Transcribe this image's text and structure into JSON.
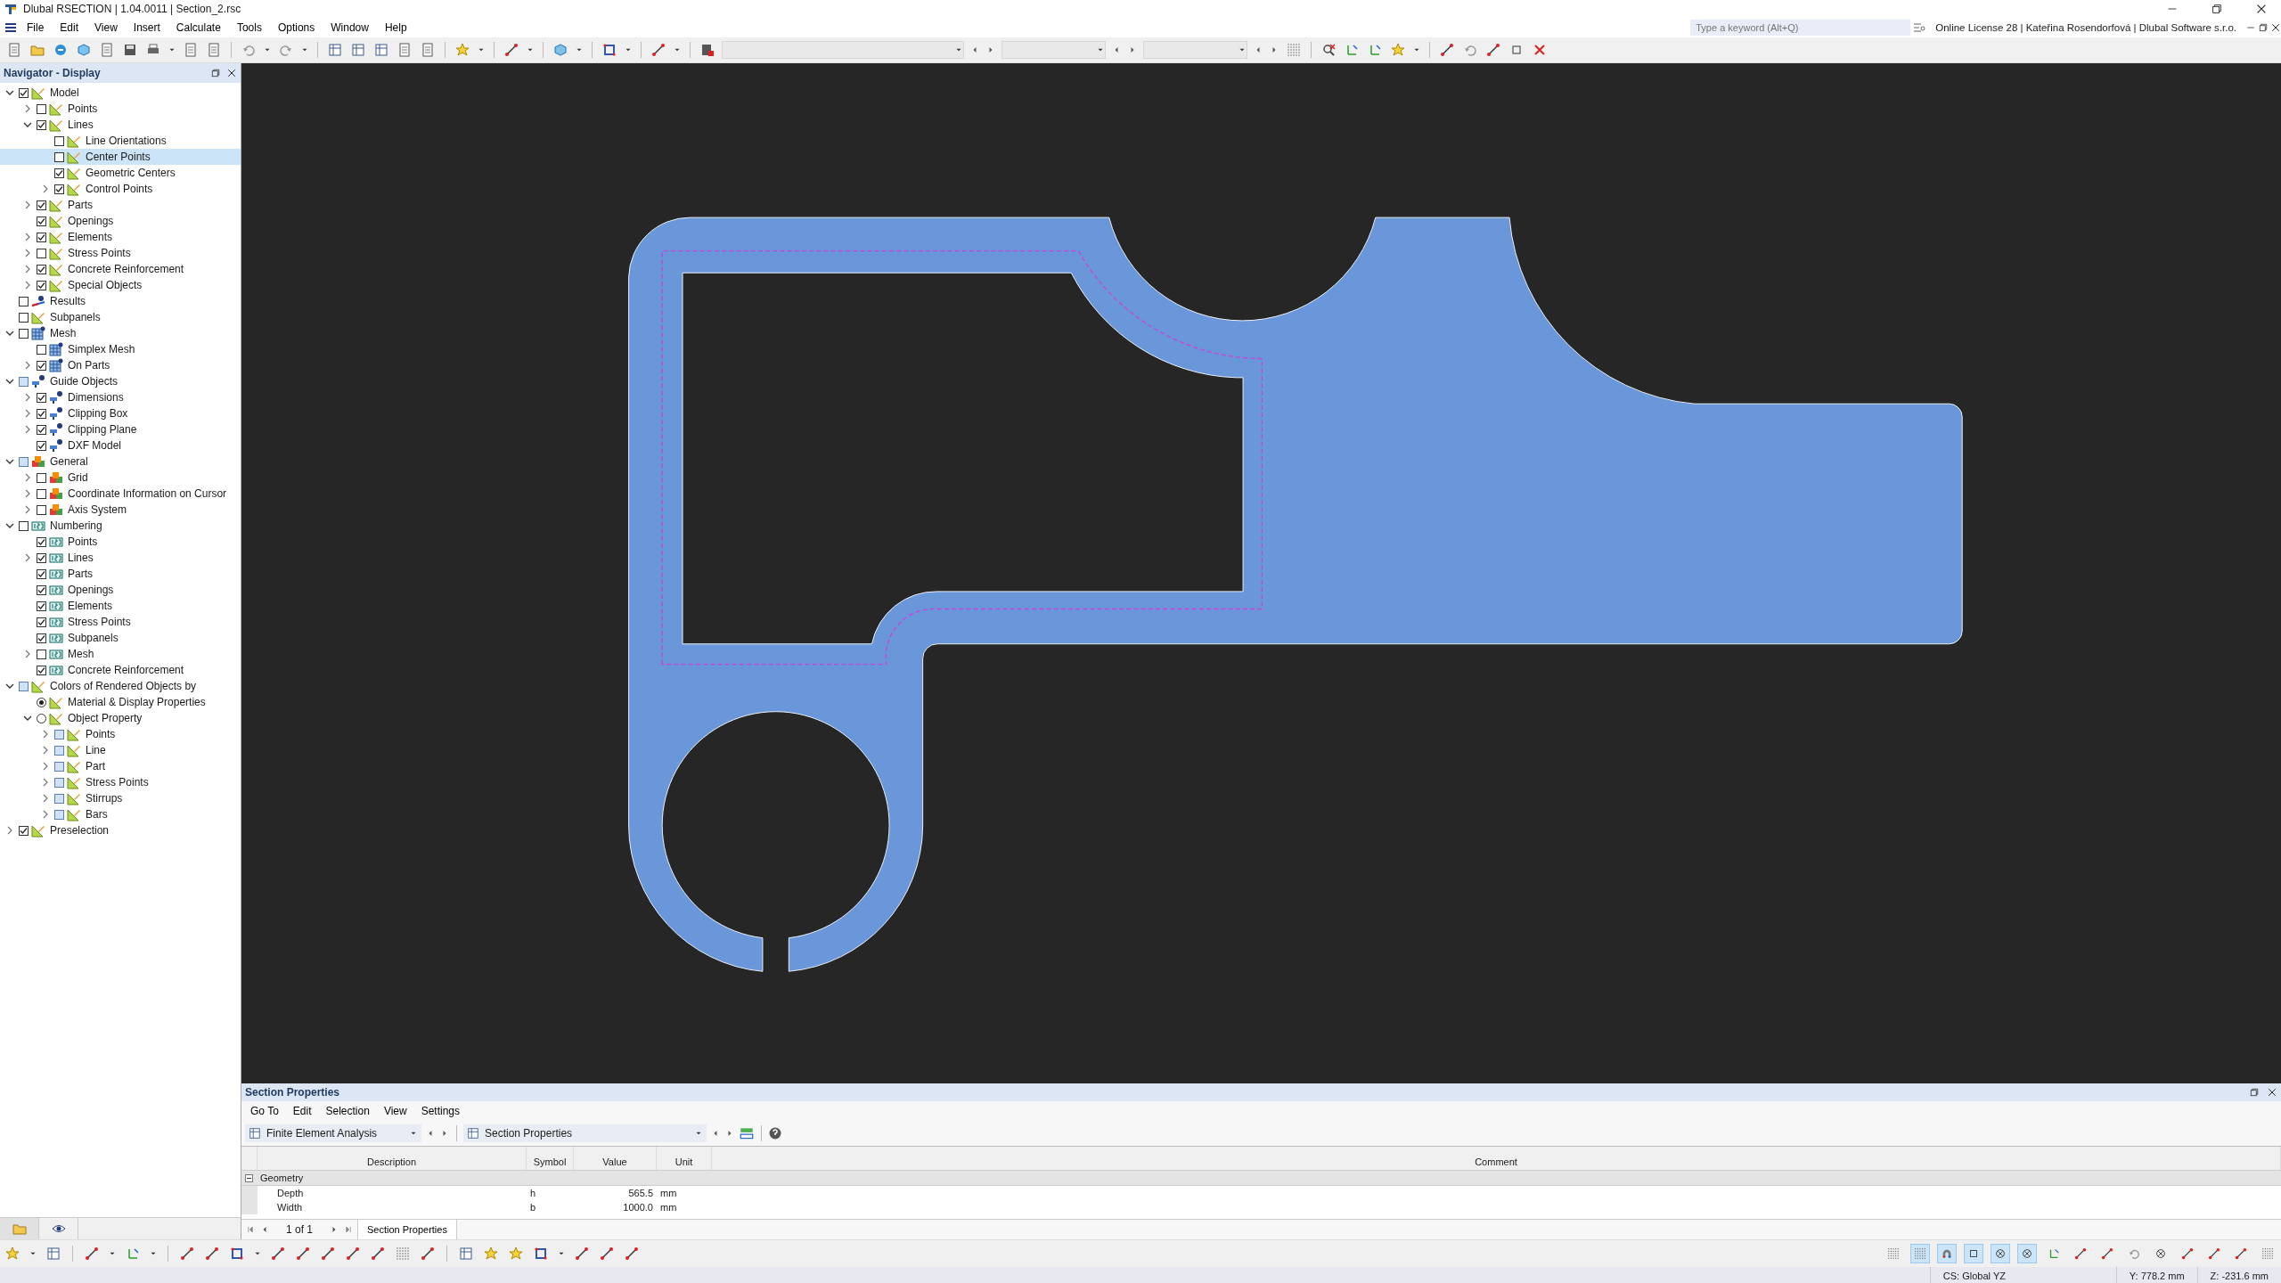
{
  "window": {
    "title": "Dlubal RSECTION | 1.04.0011 | Section_2.rsc"
  },
  "menu": [
    "File",
    "Edit",
    "View",
    "Insert",
    "Calculate",
    "Tools",
    "Options",
    "Window",
    "Help"
  ],
  "search": {
    "placeholder": "Type a keyword (Alt+Q)"
  },
  "license": "Online License 28 | Kateřina Rosendorfová | Dlubal Software s.r.o.",
  "navigator": {
    "title": "Navigator - Display",
    "tree": [
      {
        "label": "Model",
        "kind": "model",
        "expanded": true,
        "checked": true,
        "indeterminate": false,
        "selected": false,
        "children": [
          {
            "label": "Points",
            "kind": "model",
            "expanded": false,
            "checked": false,
            "indeterminate": false,
            "selected": false
          },
          {
            "label": "Lines",
            "kind": "model",
            "expanded": true,
            "checked": true,
            "indeterminate": false,
            "selected": false,
            "children": [
              {
                "label": "Line Orientations",
                "kind": "model",
                "checked": false,
                "indeterminate": false,
                "selected": false
              },
              {
                "label": "Center Points",
                "kind": "model",
                "checked": false,
                "indeterminate": false,
                "selected": true
              },
              {
                "label": "Geometric Centers",
                "kind": "model",
                "checked": true,
                "indeterminate": false,
                "selected": false
              },
              {
                "label": "Control Points",
                "kind": "model",
                "expanded": false,
                "checked": true,
                "indeterminate": false,
                "selected": false
              }
            ]
          },
          {
            "label": "Parts",
            "kind": "model",
            "expanded": false,
            "checked": true,
            "indeterminate": false,
            "selected": false
          },
          {
            "label": "Openings",
            "kind": "model",
            "checked": true,
            "indeterminate": false,
            "selected": false
          },
          {
            "label": "Elements",
            "kind": "model",
            "expanded": false,
            "checked": true,
            "indeterminate": false,
            "selected": false
          },
          {
            "label": "Stress Points",
            "kind": "model",
            "expanded": false,
            "checked": false,
            "indeterminate": false,
            "selected": false
          },
          {
            "label": "Concrete Reinforcement",
            "kind": "model",
            "expanded": false,
            "checked": true,
            "indeterminate": false,
            "selected": false
          },
          {
            "label": "Special Objects",
            "kind": "model",
            "expanded": false,
            "checked": true,
            "indeterminate": false,
            "selected": false
          }
        ]
      },
      {
        "label": "Results",
        "kind": "results",
        "checked": false,
        "indeterminate": false,
        "selected": false
      },
      {
        "label": "Subpanels",
        "kind": "model",
        "checked": false,
        "indeterminate": false,
        "selected": false
      },
      {
        "label": "Mesh",
        "kind": "mesh",
        "expanded": true,
        "checked": false,
        "indeterminate": false,
        "selected": false,
        "children": [
          {
            "label": "Simplex Mesh",
            "kind": "mesh",
            "checked": false,
            "indeterminate": false,
            "selected": false
          },
          {
            "label": "On Parts",
            "kind": "mesh",
            "expanded": false,
            "checked": true,
            "indeterminate": false,
            "selected": false
          }
        ]
      },
      {
        "label": "Guide Objects",
        "kind": "guide",
        "expanded": true,
        "checked": false,
        "indeterminate": true,
        "selected": false,
        "children": [
          {
            "label": "Dimensions",
            "kind": "guide",
            "expanded": false,
            "checked": true,
            "indeterminate": false,
            "selected": false
          },
          {
            "label": "Clipping Box",
            "kind": "guide",
            "expanded": false,
            "checked": true,
            "indeterminate": false,
            "selected": false
          },
          {
            "label": "Clipping Plane",
            "kind": "guide",
            "expanded": false,
            "checked": true,
            "indeterminate": false,
            "selected": false
          },
          {
            "label": "DXF Model",
            "kind": "guide",
            "checked": true,
            "indeterminate": false,
            "selected": false
          }
        ]
      },
      {
        "label": "General",
        "kind": "general",
        "expanded": true,
        "checked": false,
        "indeterminate": true,
        "selected": false,
        "children": [
          {
            "label": "Grid",
            "kind": "general",
            "expanded": false,
            "checked": false,
            "indeterminate": false,
            "selected": false
          },
          {
            "label": "Coordinate Information on Cursor",
            "kind": "general",
            "expanded": false,
            "checked": false,
            "indeterminate": false,
            "selected": false
          },
          {
            "label": "Axis System",
            "kind": "general",
            "expanded": false,
            "checked": false,
            "indeterminate": false,
            "selected": false
          }
        ]
      },
      {
        "label": "Numbering",
        "kind": "numbering",
        "expanded": true,
        "checked": false,
        "indeterminate": false,
        "selected": false,
        "children": [
          {
            "label": "Points",
            "kind": "numbering",
            "checked": true,
            "indeterminate": false,
            "selected": false
          },
          {
            "label": "Lines",
            "kind": "numbering",
            "expanded": false,
            "checked": true,
            "indeterminate": false,
            "selected": false
          },
          {
            "label": "Parts",
            "kind": "numbering",
            "checked": true,
            "indeterminate": false,
            "selected": false
          },
          {
            "label": "Openings",
            "kind": "numbering",
            "checked": true,
            "indeterminate": false,
            "selected": false
          },
          {
            "label": "Elements",
            "kind": "numbering",
            "checked": true,
            "indeterminate": false,
            "selected": false
          },
          {
            "label": "Stress Points",
            "kind": "numbering",
            "checked": true,
            "indeterminate": false,
            "selected": false
          },
          {
            "label": "Subpanels",
            "kind": "numbering",
            "checked": true,
            "indeterminate": false,
            "selected": false
          },
          {
            "label": "Mesh",
            "kind": "numbering",
            "expanded": false,
            "checked": false,
            "indeterminate": false,
            "selected": false
          },
          {
            "label": "Concrete Reinforcement",
            "kind": "numbering",
            "checked": true,
            "indeterminate": false,
            "selected": false
          }
        ]
      },
      {
        "label": "Colors of Rendered Objects by",
        "kind": "model",
        "expanded": true,
        "checked": false,
        "indeterminate": true,
        "selected": false,
        "children": [
          {
            "label": "Material & Display Properties",
            "kind": "model-radio",
            "checked": true,
            "indeterminate": false,
            "selected": false
          },
          {
            "label": "Object Property",
            "kind": "model-radio",
            "expanded": true,
            "checked": false,
            "indeterminate": false,
            "selected": false,
            "children": [
              {
                "label": "Points",
                "kind": "model",
                "expanded": false,
                "checked": false,
                "indeterminate": true,
                "selected": false
              },
              {
                "label": "Line",
                "kind": "model",
                "expanded": false,
                "checked": false,
                "indeterminate": true,
                "selected": false
              },
              {
                "label": "Part",
                "kind": "model",
                "expanded": false,
                "checked": false,
                "indeterminate": true,
                "selected": false
              },
              {
                "label": "Stress Points",
                "kind": "model",
                "expanded": false,
                "checked": false,
                "indeterminate": true,
                "selected": false
              },
              {
                "label": "Stirrups",
                "kind": "model",
                "expanded": false,
                "checked": false,
                "indeterminate": true,
                "selected": false
              },
              {
                "label": "Bars",
                "kind": "model",
                "expanded": false,
                "checked": false,
                "indeterminate": true,
                "selected": false
              }
            ]
          }
        ]
      },
      {
        "label": "Preselection",
        "kind": "model",
        "expanded": false,
        "checked": true,
        "indeterminate": false,
        "selected": false
      }
    ],
    "bottom_tabs": [
      {
        "kind": "data",
        "selected": true
      },
      {
        "kind": "view",
        "selected": false
      }
    ]
  },
  "section_properties": {
    "title": "Section Properties",
    "menu": [
      "Go To",
      "Edit",
      "Selection",
      "View",
      "Settings"
    ],
    "analysis_select": "Finite Element Analysis",
    "table_select": "Section Properties",
    "columns": [
      "Description",
      "Symbol",
      "Value",
      "Unit",
      "Comment"
    ],
    "groups": [
      {
        "label": "Geometry",
        "expanded": true,
        "rows": [
          {
            "description": "Depth",
            "symbol": "h",
            "value": "565.5",
            "unit": "mm"
          },
          {
            "description": "Width",
            "symbol": "b",
            "value": "1000.0",
            "unit": "mm"
          }
        ]
      }
    ],
    "pager": "1 of 1",
    "sheets": [
      {
        "label": "Section Properties",
        "selected": true
      }
    ]
  },
  "snap_toggles": [
    {
      "selected": false
    },
    {
      "selected": true
    },
    {
      "selected": true
    },
    {
      "selected": true
    },
    {
      "selected": true
    },
    {
      "selected": true
    },
    {
      "selected": false
    },
    {
      "selected": false
    },
    {
      "selected": false
    },
    {
      "selected": false
    },
    {
      "selected": false
    },
    {
      "selected": false
    },
    {
      "selected": false
    },
    {
      "selected": false
    },
    {
      "selected": false
    }
  ],
  "status_bar": {
    "coordinate_system": "CS: Global YZ",
    "y": "Y: 778.2 mm",
    "z": "Z: -231.6 mm"
  }
}
